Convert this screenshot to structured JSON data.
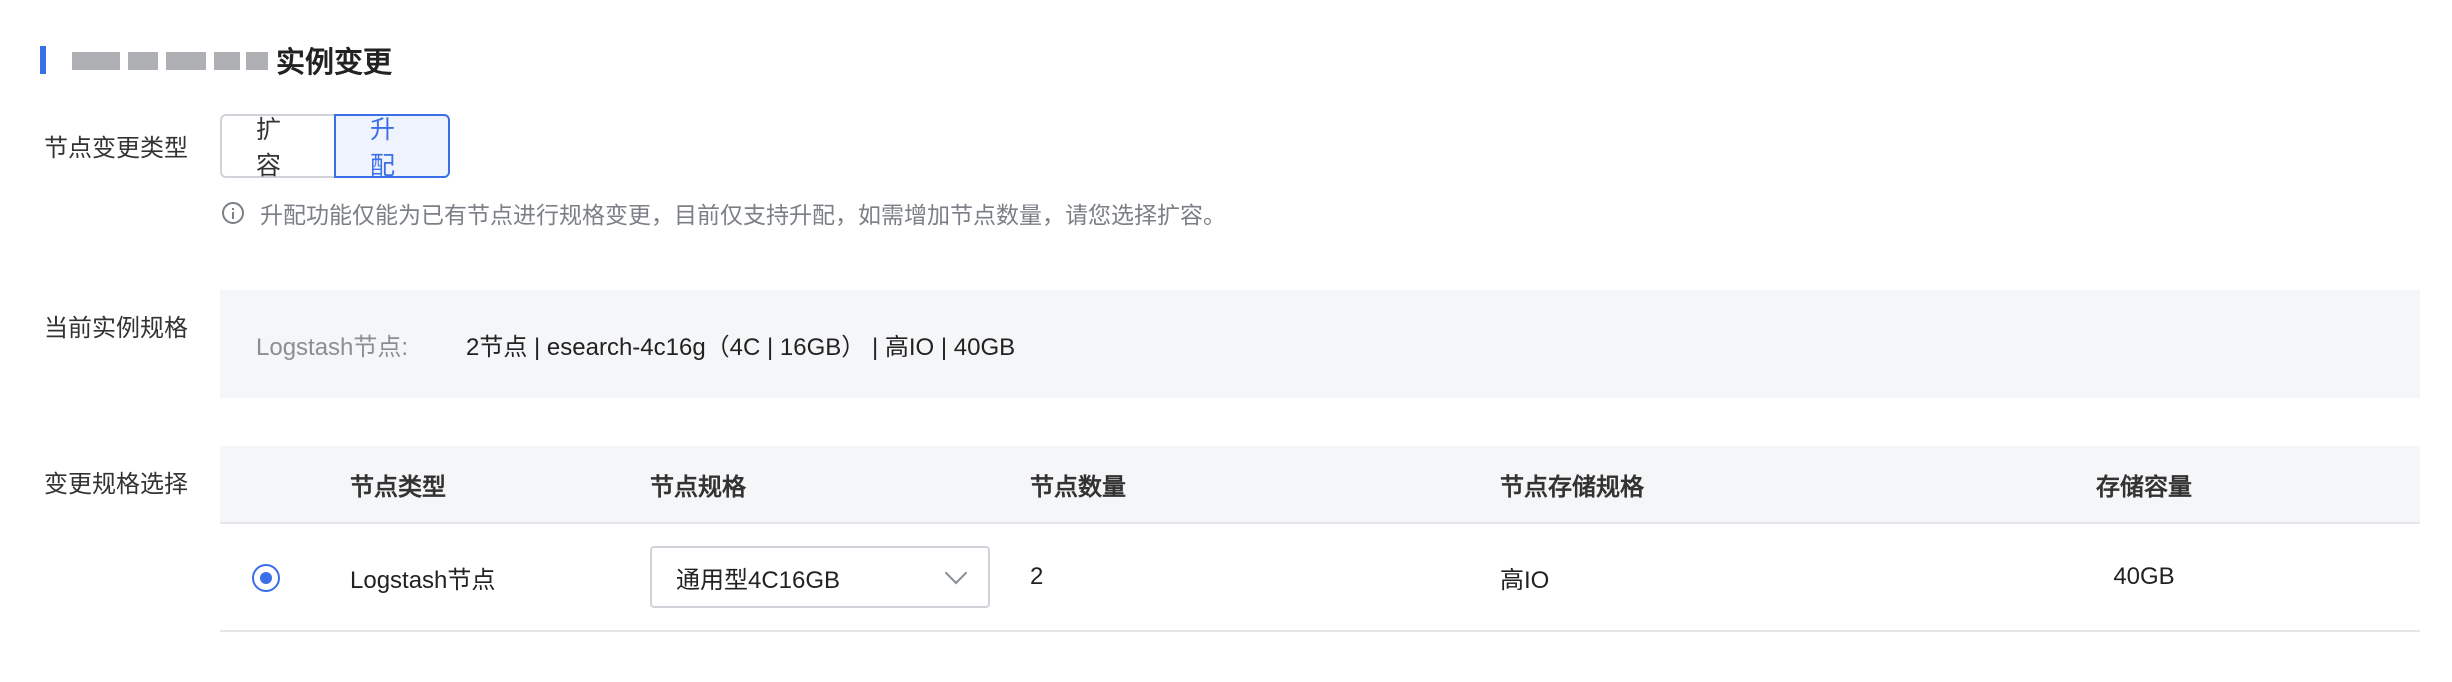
{
  "header": {
    "title": "实例变更"
  },
  "change_type": {
    "label": "节点变更类型",
    "options": [
      "扩容",
      "升配"
    ],
    "selected": "升配",
    "hint": "升配功能仅能为已有节点进行规格变更，目前仅支持升配，如需增加节点数量，请您选择扩容。",
    "hint_icon": "info-icon"
  },
  "current_spec": {
    "label": "当前实例规格",
    "key": "Logstash节点:",
    "value": "2节点 | esearch-4c16g（4C | 16GB） | 高IO | 40GB"
  },
  "change_spec": {
    "label": "变更规格选择",
    "columns": [
      "节点类型",
      "节点规格",
      "节点数量",
      "节点存储规格",
      "存储容量"
    ],
    "rows": [
      {
        "selected": true,
        "node_type": "Logstash节点",
        "node_spec": "通用型4C16GB",
        "node_count": "2",
        "storage_type": "高IO",
        "capacity": "40GB"
      }
    ]
  },
  "colors": {
    "accent": "#3b6fe8",
    "panel_bg": "#f5f6f8"
  }
}
